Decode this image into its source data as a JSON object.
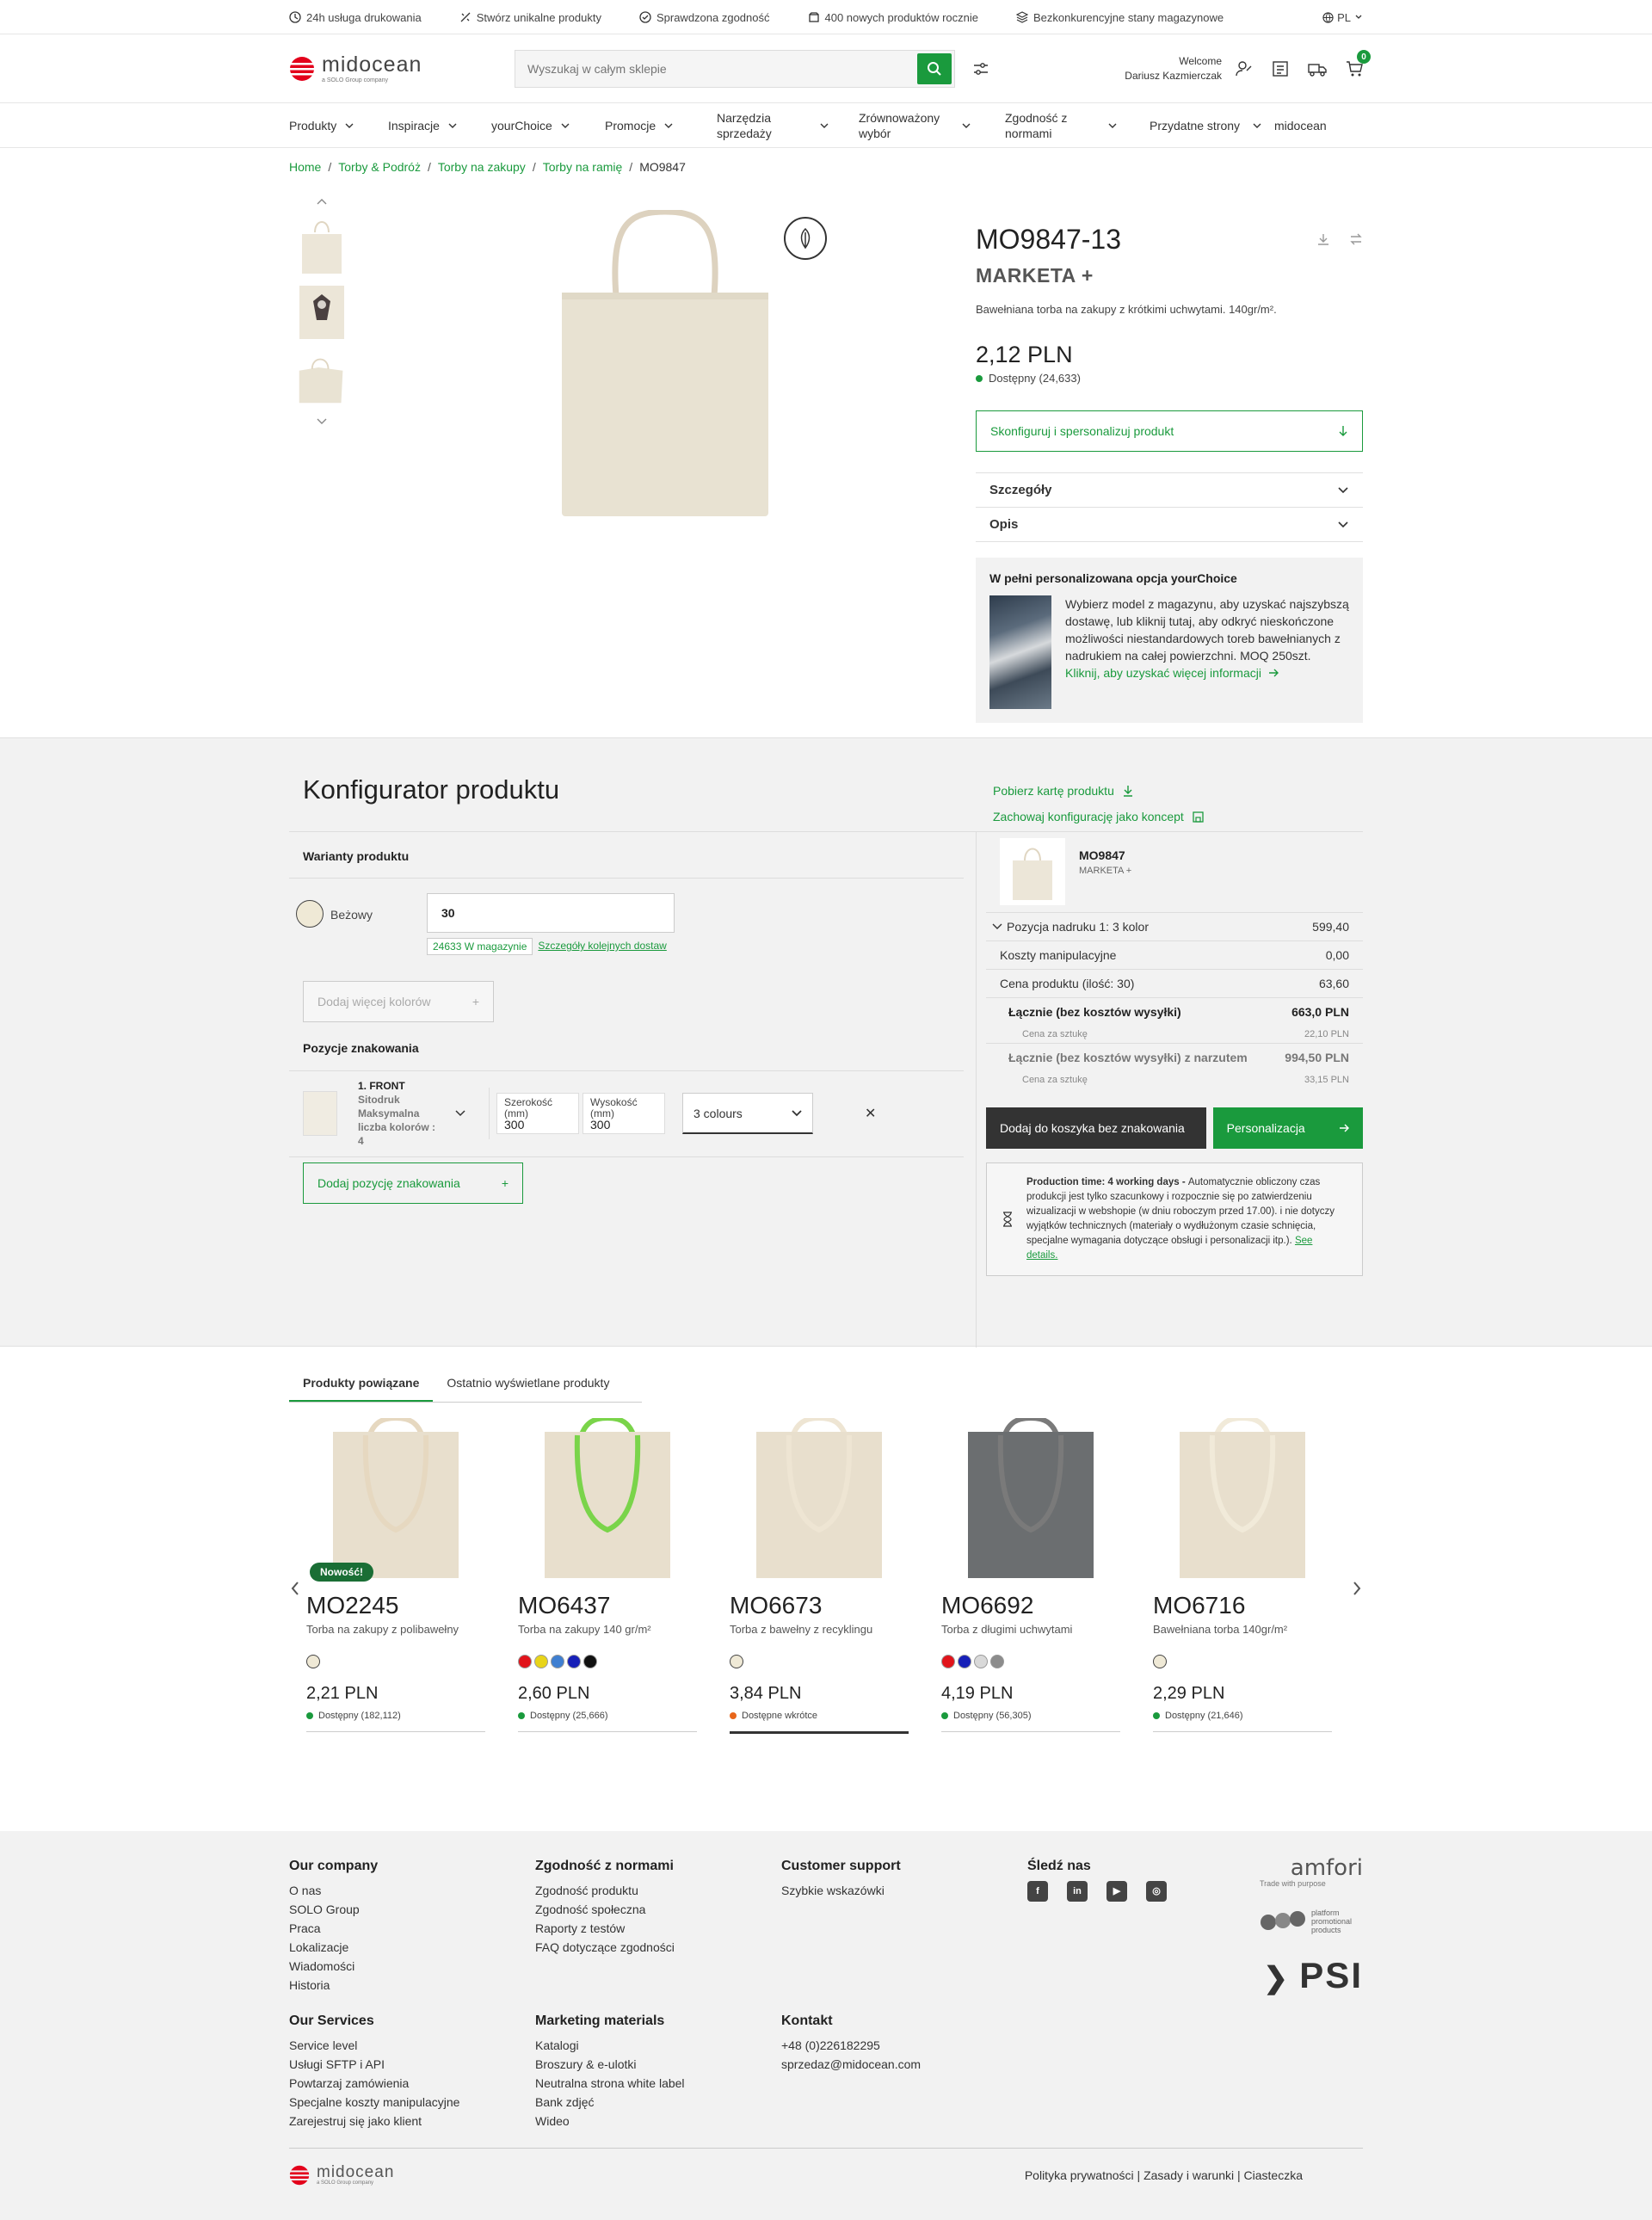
{
  "usp": [
    {
      "icon": "clock-icon",
      "text": "24h usługa drukowania"
    },
    {
      "icon": "sparkle-icon",
      "text": "Stwórz unikalne produkty"
    },
    {
      "icon": "check-circle-icon",
      "text": "Sprawdzona zgodność"
    },
    {
      "icon": "box-icon",
      "text": "400 nowych produktów rocznie"
    },
    {
      "icon": "layers-icon",
      "text": "Bezkonkurencyjne stany magazynowe"
    }
  ],
  "lang": "PL",
  "logo": {
    "name": "midocean",
    "sub": "a SOLO Group company"
  },
  "search": {
    "placeholder": "Wyszukaj w całym sklepie"
  },
  "user": {
    "welcome": "Welcome",
    "name": "Dariusz Kazmierczak"
  },
  "cart_count": "0",
  "nav": [
    "Produkty",
    "Inspiracje",
    "yourChoice",
    "Promocje",
    "Narzędzia sprzedaży",
    "Zrównoważony wybór",
    "Zgodność z normami",
    "Przydatne strony",
    "midocean"
  ],
  "breadcrumb": [
    "Home",
    "Torby & Podróż",
    "Torby na zakupy",
    "Torby na ramię",
    "MO9847"
  ],
  "product": {
    "sku": "MO9847-13",
    "name": "MARKETA +",
    "desc": "Bawełniana torba na zakupy z krótkimi uchwytami. 140gr/m².",
    "price": "2,12 PLN",
    "availability": "Dostępny (24,633)",
    "configure_btn": "Skonfiguruj i spersonalizuj produkt",
    "accordion": [
      "Szczegóły",
      "Opis"
    ],
    "yourchoice": {
      "title": "W pełni personalizowana opcja yourChoice",
      "text": "Wybierz model z magazynu, aby uzyskać najszybszą dostawę, lub kliknij tutaj, aby odkryć nieskończone możliwości niestandardowych toreb bawełnianych z nadrukiem na całej powierzchni. MOQ 250szt.",
      "link": "Kliknij, aby uzyskać więcej informacji"
    }
  },
  "configurator": {
    "title": "Konfigurator produktu",
    "download": "Pobierz kartę produktu",
    "save": "Zachowaj konfigurację jako koncept",
    "variants_label": "Warianty produktu",
    "color_name": "Beżowy",
    "quantity": "30",
    "stock": "24633 W magazynie",
    "delivery_link": "Szczegóły kolejnych dostaw",
    "more_colors": "Dodaj więcej kolorów",
    "positions_label": "Pozycje znakowania",
    "position": {
      "name": "1. FRONT",
      "method": "Sitodruk",
      "max": "Maksymalna liczba kolorów : 4"
    },
    "width_label": "Szerokość (mm)",
    "width": "300",
    "height_label": "Wysokość (mm)",
    "height": "300",
    "colours": "3 colours",
    "add_position": "Dodaj pozycję znakowania"
  },
  "summary": {
    "sku": "MO9847",
    "name": "MARKETA +",
    "rows": [
      {
        "label": "Pozycja nadruku 1: 3 kolor",
        "value": "599,40"
      },
      {
        "label": "Koszty manipulacyjne",
        "value": "0,00"
      },
      {
        "label": "Cena produktu (ilość: 30)",
        "value": "63,60"
      }
    ],
    "total_label": "Łącznie (bez kosztów wysyłki)",
    "total": "663,0 PLN",
    "unit_label": "Cena za sztukę",
    "unit": "22,10 PLN",
    "total2_label": "Łącznie (bez kosztów wysyłki) z narzutem",
    "total2": "994,50 PLN",
    "unit2": "33,15 PLN",
    "btn_cart": "Dodaj do koszyka bez znakowania",
    "btn_personal": "Personalizacja",
    "note_bold": "Production time: 4 working days - ",
    "note": "Automatycznie obliczony czas produkcji jest tylko szacunkowy i rozpocznie się po zatwierdzeniu wizualizacji w webshopie (w dniu roboczym przed 17.00). i nie dotyczy wyjątków technicznych (materiały o wydłużonym czasie schnięcia, specjalne wymagania dotyczące obsługi i personalizacji itp.).",
    "note_link": "See details."
  },
  "tabs": [
    "Produkty powiązane",
    "Ostatnio wyświetlane produkty"
  ],
  "related": [
    {
      "sku": "MO2245",
      "desc": "Torba na zakupy z polibawełny",
      "price": "2,21 PLN",
      "avail": "Dostępny (182,112)",
      "new": "Nowość!",
      "colors": [
        "#efe9d6"
      ],
      "status": "#1a9a3d",
      "handle": "#e6d8c0"
    },
    {
      "sku": "MO6437",
      "desc": "Torba na zakupy 140 gr/m²",
      "price": "2,60 PLN",
      "avail": "Dostępny (25,666)",
      "colors": [
        "#e1141b",
        "#e8d419",
        "#3f7fd1",
        "#1720b8",
        "#111111"
      ],
      "status": "#1a9a3d",
      "handle": "#7ad44a"
    },
    {
      "sku": "MO6673",
      "desc": "Torba z bawełny z recyklingu",
      "price": "3,84 PLN",
      "avail": "Dostępne wkrótce",
      "colors": [
        "#efe9d6"
      ],
      "status": "#e8661b",
      "handle": "#eee5d3"
    },
    {
      "sku": "MO6692",
      "desc": "Torba z długimi uchwytami",
      "price": "4,19 PLN",
      "avail": "Dostępny (56,305)",
      "colors": [
        "#e1141b",
        "#1720b8",
        "#d9d9d9",
        "#8c8c8c"
      ],
      "status": "#1a9a3d",
      "handle": "#7a7a7a"
    },
    {
      "sku": "MO6716",
      "desc": "Bawełniana torba 140gr/m²",
      "price": "2,29 PLN",
      "avail": "Dostępny (21,646)",
      "colors": [
        "#efe9d6"
      ],
      "status": "#1a9a3d",
      "handle": "#f1ead9"
    }
  ],
  "footer": {
    "cols": [
      {
        "title": "Our company",
        "items": [
          "O nas",
          "SOLO Group",
          "Praca",
          "Lokalizacje",
          "Wiadomości",
          "Historia"
        ]
      },
      {
        "title": "Zgodność z normami",
        "items": [
          "Zgodność produktu",
          "Zgodność społeczna",
          "Raporty z testów",
          "FAQ dotyczące zgodności"
        ]
      },
      {
        "title": "Customer support",
        "items": [
          "Szybkie wskazówki"
        ]
      },
      {
        "title": "Śledź nas",
        "items": []
      },
      {
        "title": "Our Services",
        "items": [
          "Service level",
          "Usługi SFTP i API",
          "Powtarzaj zamówienia",
          "Specjalne koszty manipulacyjne",
          "Zarejestruj się jako klient"
        ]
      },
      {
        "title": "Marketing materials",
        "items": [
          "Katalogi",
          "Broszury & e-ulotki",
          "Neutralna strona white label",
          "Bank zdjęć",
          "Wideo"
        ]
      },
      {
        "title": "Kontakt",
        "items": [
          "+48 (0)226182295",
          "sprzedaz@midocean.com"
        ]
      }
    ],
    "partners": {
      "amfori": "amfori",
      "amfori_sub": "Trade with purpose",
      "ppp": "platform promotional products",
      "psi": "PSI"
    },
    "links": "Polityka prywatności | Zasady i warunki | Ciasteczka"
  },
  "colors": {
    "accent": "#1a9a3d",
    "dark": "#333333",
    "panel": "#f2f2f2"
  }
}
